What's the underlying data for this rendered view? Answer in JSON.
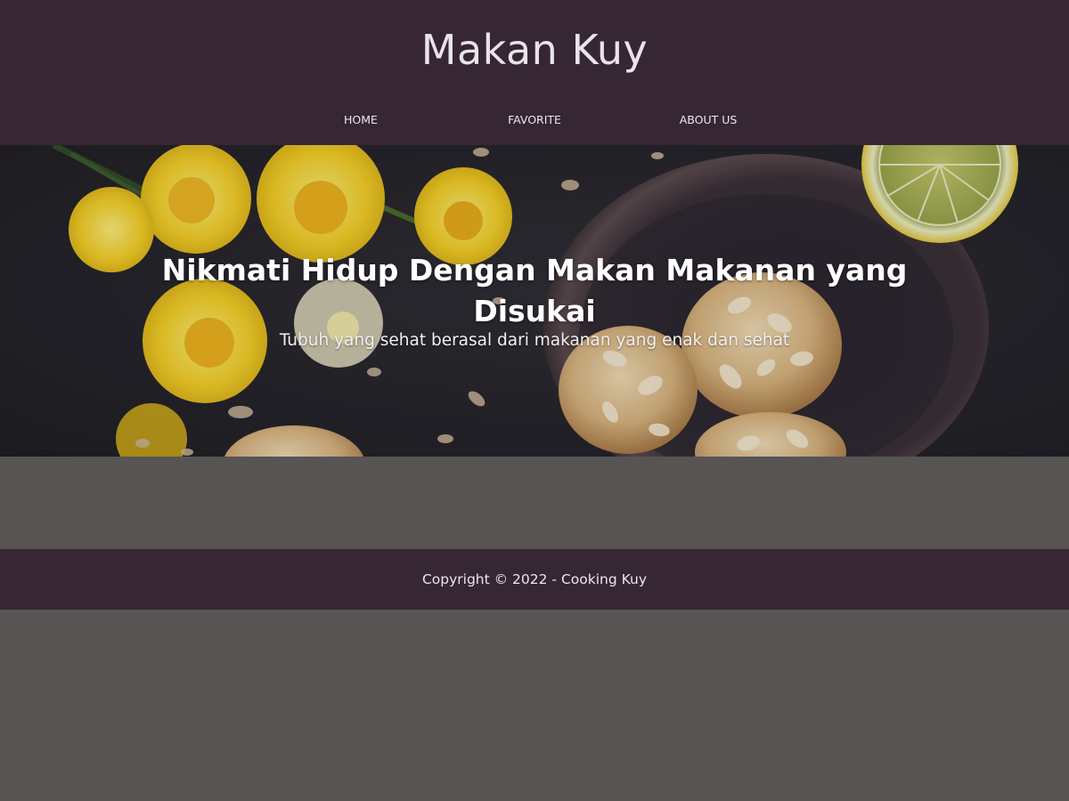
{
  "header": {
    "brand": "Makan Kuy",
    "nav": [
      {
        "label": "HOME"
      },
      {
        "label": "FAVORITE"
      },
      {
        "label": "ABOUT US"
      }
    ]
  },
  "hero": {
    "title": "Nikmati Hidup Dengan Makan Makanan yang Disukai",
    "subtitle": "Tubuh yang sehat berasal dari makanan yang enak dan sehat"
  },
  "footer": {
    "copyright": "Copyright © 2022 - Cooking Kuy"
  },
  "colors": {
    "header_bg": "#372633",
    "page_bg": "#575454",
    "hero_bg": "#27252b",
    "text_light": "#ece7ee"
  },
  "icons": {
    "hero_image": "cookies-and-daffodils-photo"
  }
}
